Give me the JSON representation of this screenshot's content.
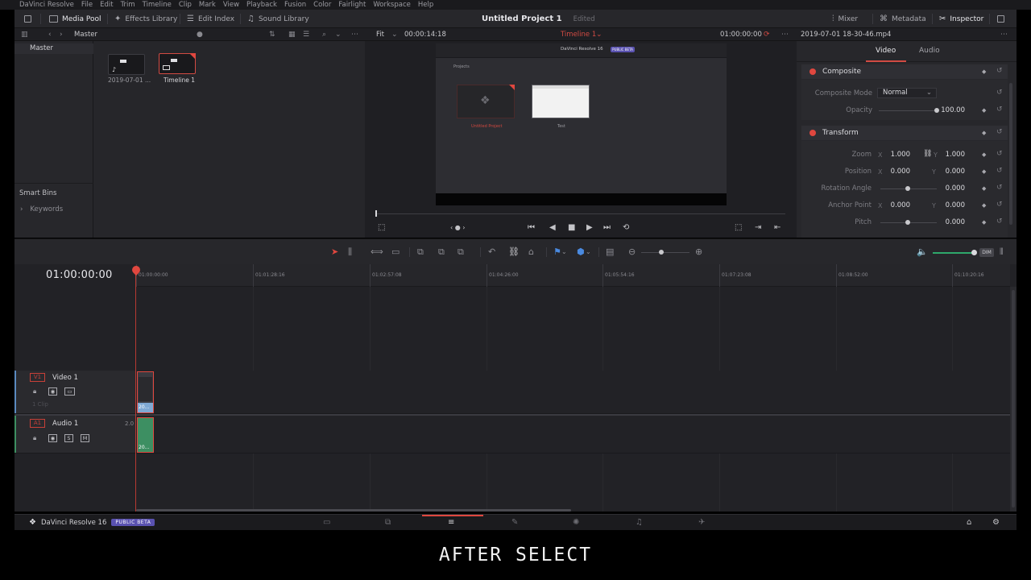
{
  "menubar": {
    "items": [
      "DaVinci Resolve",
      "File",
      "Edit",
      "Trim",
      "Timeline",
      "Clip",
      "Mark",
      "View",
      "Playback",
      "Fusion",
      "Color",
      "Fairlight",
      "Workspace",
      "Help"
    ]
  },
  "toolbar": {
    "media_pool": "Media Pool",
    "effects_library": "Effects Library",
    "edit_index": "Edit Index",
    "sound_library": "Sound Library",
    "project_title": "Untitled Project 1",
    "status": "Edited",
    "mixer": "Mixer",
    "metadata": "Metadata",
    "inspector": "Inspector"
  },
  "media_pool": {
    "bin": "Master",
    "zoom": "Fit",
    "duration": "00:00:14:18",
    "clips": [
      {
        "label": "2019-07-01 ...",
        "type": "audio-video"
      },
      {
        "label": "Timeline 1",
        "type": "timeline",
        "selected": true
      }
    ],
    "smart_bins": "Smart Bins",
    "keywords": "Keywords"
  },
  "viewer": {
    "timeline_name": "Timeline 1",
    "timecode": "01:00:00:00",
    "frame": {
      "app_title": "DaVinci Resolve 16",
      "badge": "PUBLIC BETA",
      "section": "Projects",
      "project1": "Untitled Project",
      "project2": "Test"
    }
  },
  "inspector": {
    "clip_name": "2019-07-01 18-30-46.mp4",
    "tabs": [
      "Video",
      "Audio"
    ],
    "active_tab": "Video",
    "composite": {
      "title": "Composite",
      "mode_label": "Composite Mode",
      "mode_value": "Normal",
      "opacity_label": "Opacity",
      "opacity_value": "100.00"
    },
    "transform": {
      "title": "Transform",
      "zoom_label": "Zoom",
      "zoom_x": "1.000",
      "zoom_y": "1.000",
      "position_label": "Position",
      "position_x": "0.000",
      "position_y": "0.000",
      "rotation_label": "Rotation Angle",
      "rotation_value": "0.000",
      "anchor_label": "Anchor Point",
      "anchor_x": "0.000",
      "anchor_y": "0.000",
      "pitch_label": "Pitch",
      "pitch_value": "0.000"
    },
    "axis_x": "X",
    "axis_y": "Y"
  },
  "timeline": {
    "timecode": "01:00:00:00",
    "ruler_labels": [
      "01:00:00:00",
      "01:01:28:16",
      "01:02:57:08",
      "01:04:26:00",
      "01:05:54:16",
      "01:07:23:08",
      "01:08:52:00",
      "01:10:20:16"
    ],
    "video_track": {
      "id": "V1",
      "name": "Video 1",
      "clips_count": "1 Clip",
      "clip_label": "20..."
    },
    "audio_track": {
      "id": "A1",
      "name": "Audio 1",
      "channels": "2.0",
      "clip_label": "20..."
    },
    "dim_label": "DIM"
  },
  "pagebar": {
    "app_name": "DaVinci Resolve 16",
    "badge": "PUBLIC BETA",
    "active_page": "edit"
  },
  "caption": "AFTER SELECT",
  "colors": {
    "accent": "#e0473f",
    "beta": "#5a52b0",
    "audio_clip": "#3d8f62",
    "video_clip_label": "#7fa9d4"
  }
}
